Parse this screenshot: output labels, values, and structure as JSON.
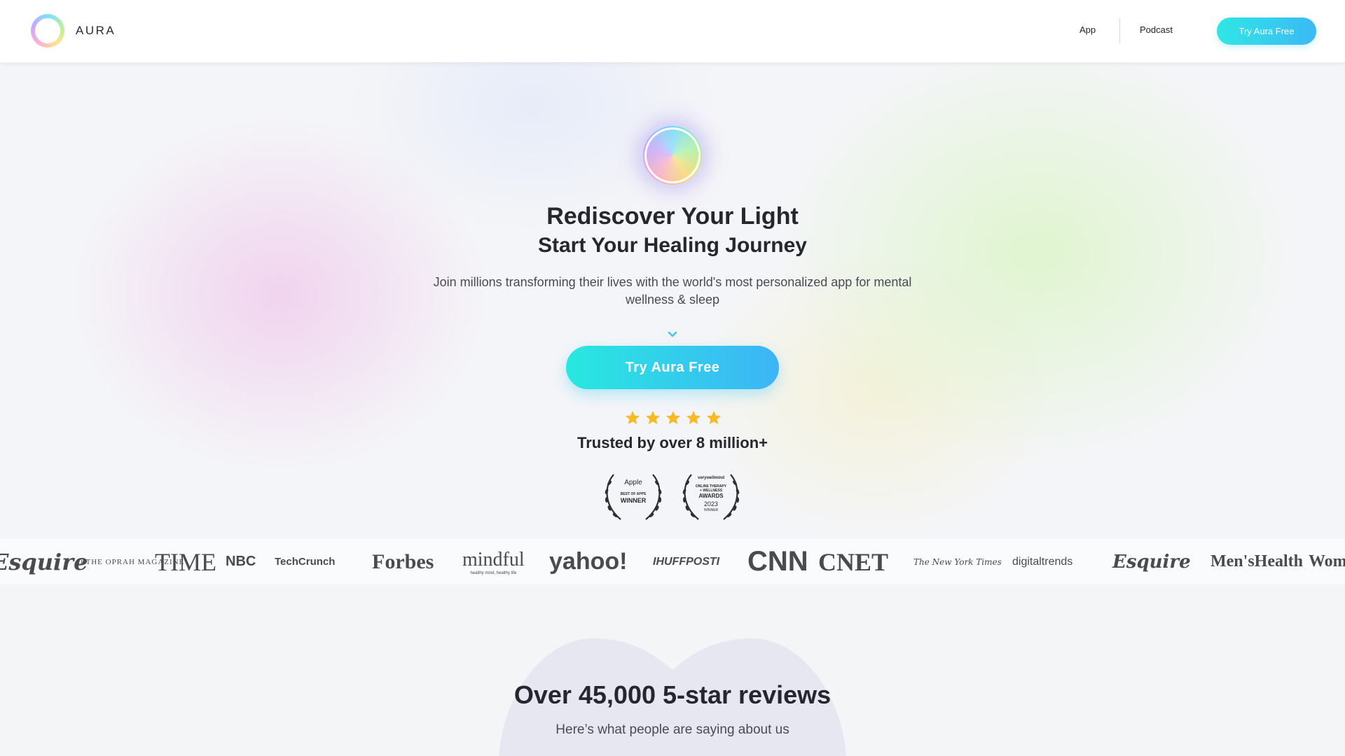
{
  "header": {
    "brand": "AURA",
    "nav": {
      "app": "App",
      "podcast": "Podcast"
    },
    "cta": "Try Aura Free"
  },
  "hero": {
    "title": "Rediscover Your Light",
    "subtitle": "Start Your Healing Journey",
    "description": "Join millions transforming their lives with the world's most personalized app for mental wellness & sleep",
    "cta": "Try Aura Free",
    "rating_stars": 5,
    "trusted": "Trusted by over 8 million+",
    "awards": [
      {
        "brand": "Apple",
        "line1": "BEST OF APPS",
        "line2": "WINNER"
      },
      {
        "brand": "verywellmind",
        "line1": "ONLINE THERAPY",
        "line2": "+ WELLNESS",
        "line3": "AWARDS",
        "year": "2023",
        "line4": "WINNER"
      }
    ]
  },
  "press": {
    "logos": [
      "Esquire",
      "O THE OPRAH MAGAZINE",
      "TIME",
      "NBC",
      "TechCrunch",
      "Forbes",
      "mindful",
      "yahoo!",
      "IHUFFPOSTI",
      "CNN",
      "CNET",
      "The New York Times",
      "digitaltrends",
      "Esquire",
      "Men'sHealth",
      "Women"
    ],
    "mindful_tagline": "healthy mind, healthy life"
  },
  "reviews": {
    "title": "Over 45,000 5-star reviews",
    "subtitle": "Here’s what people are saying about us"
  },
  "colors": {
    "accent_start": "#2fe7e4",
    "accent_end": "#3bb9f6",
    "star": "#f7b924",
    "text": "#26262e"
  }
}
